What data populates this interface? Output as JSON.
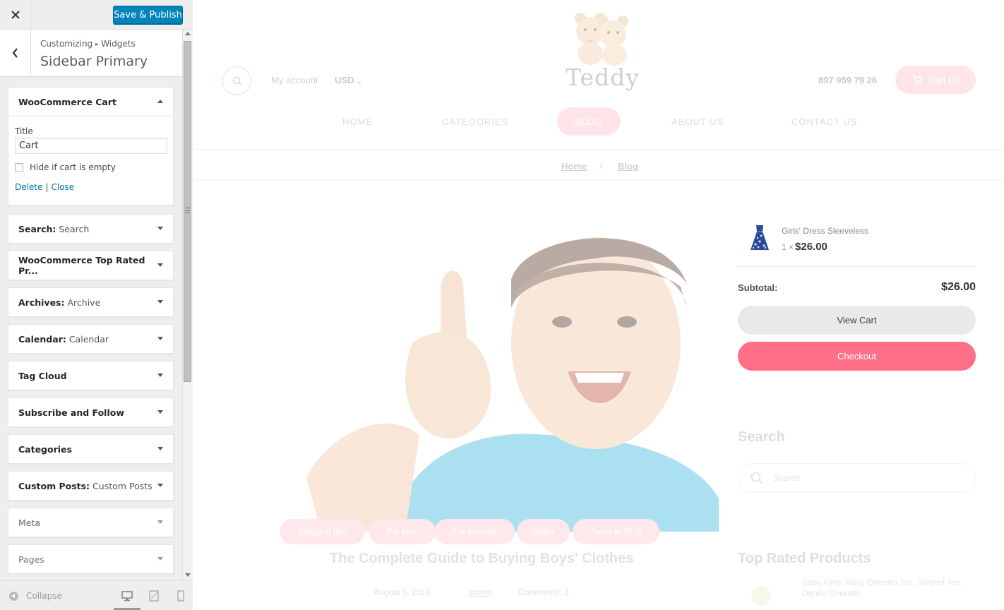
{
  "panel": {
    "close_icon": "close-icon",
    "publish_label": "Save & Publish",
    "breadcrumb_parent": "Customizing",
    "breadcrumb_child": "Widgets",
    "section_title": "Sidebar Primary",
    "expanded_widget": {
      "title_bold": "WooCommerce Cart",
      "field_label": "Title",
      "field_value": "Cart",
      "checkbox_label": "Hide if cart is empty",
      "checkbox_checked": false,
      "delete_label": "Delete",
      "separator": "|",
      "close_label": "Close"
    },
    "widgets": [
      {
        "name": "Search:",
        "sub": "Search"
      },
      {
        "name": "WooCommerce Top Rated Pr...",
        "sub": ""
      },
      {
        "name": "Archives:",
        "sub": "Archive"
      },
      {
        "name": "Calendar:",
        "sub": "Calendar"
      },
      {
        "name": "Tag Cloud",
        "sub": ""
      },
      {
        "name": "Subscribe and Follow",
        "sub": ""
      },
      {
        "name": "Categories",
        "sub": ""
      },
      {
        "name": "Custom Posts:",
        "sub": "Custom Posts"
      },
      {
        "name": "Meta",
        "sub": ""
      },
      {
        "name": "Pages",
        "sub": ""
      }
    ],
    "collapse_label": "Collapse",
    "accent_color": "#0085ba"
  },
  "preview": {
    "my_account": "My account",
    "currency": "USD",
    "logo_text": "Teddy",
    "phone": "897 959 79 26",
    "cart_label": "Cart (1)",
    "nav": [
      "HOME",
      "CATEGORIES",
      "BLOG",
      "ABOUT US",
      "CONTACT US"
    ],
    "breadcrumb": [
      "Home",
      "/",
      "Blog"
    ],
    "tags": [
      "Blogging tips",
      "For kids",
      "For parents",
      "Slider",
      "Trend in 2016"
    ],
    "post_title": "The Complete Guide to Buying Boys' Clothes",
    "post_meta": [
      "August 5, 2016",
      "admin",
      "Comments: 3"
    ],
    "mini_cart": {
      "product_name": "Girls' Dress Sleeveless",
      "qty": "1 ×",
      "price": "$26.00",
      "subtotal_label": "Subtotal:",
      "subtotal_value": "$26.00",
      "view_cart": "View Cart",
      "checkout": "Checkout",
      "checkout_color": "#ff7088"
    },
    "search_heading": "Search",
    "search_placeholder": "Search",
    "top_rated_heading": "Top Rated Products",
    "top_rated_item": "Baby Girls' Navy Overalls Set, Striped Tee, Denim Overalls"
  }
}
